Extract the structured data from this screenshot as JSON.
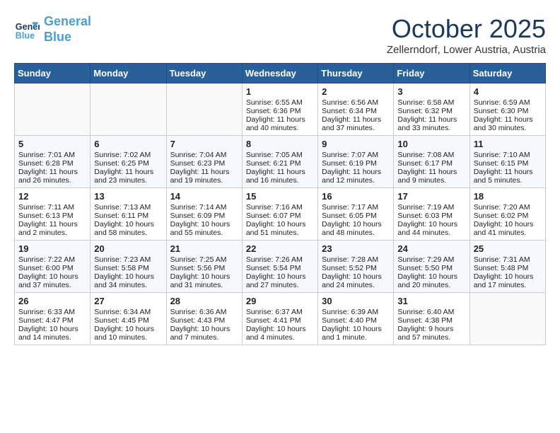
{
  "header": {
    "logo_line1": "General",
    "logo_line2": "Blue",
    "month": "October 2025",
    "location": "Zellerndorf, Lower Austria, Austria"
  },
  "weekdays": [
    "Sunday",
    "Monday",
    "Tuesday",
    "Wednesday",
    "Thursday",
    "Friday",
    "Saturday"
  ],
  "weeks": [
    [
      {
        "day": "",
        "content": ""
      },
      {
        "day": "",
        "content": ""
      },
      {
        "day": "",
        "content": ""
      },
      {
        "day": "1",
        "content": "Sunrise: 6:55 AM\nSunset: 6:36 PM\nDaylight: 11 hours\nand 40 minutes."
      },
      {
        "day": "2",
        "content": "Sunrise: 6:56 AM\nSunset: 6:34 PM\nDaylight: 11 hours\nand 37 minutes."
      },
      {
        "day": "3",
        "content": "Sunrise: 6:58 AM\nSunset: 6:32 PM\nDaylight: 11 hours\nand 33 minutes."
      },
      {
        "day": "4",
        "content": "Sunrise: 6:59 AM\nSunset: 6:30 PM\nDaylight: 11 hours\nand 30 minutes."
      }
    ],
    [
      {
        "day": "5",
        "content": "Sunrise: 7:01 AM\nSunset: 6:28 PM\nDaylight: 11 hours\nand 26 minutes."
      },
      {
        "day": "6",
        "content": "Sunrise: 7:02 AM\nSunset: 6:25 PM\nDaylight: 11 hours\nand 23 minutes."
      },
      {
        "day": "7",
        "content": "Sunrise: 7:04 AM\nSunset: 6:23 PM\nDaylight: 11 hours\nand 19 minutes."
      },
      {
        "day": "8",
        "content": "Sunrise: 7:05 AM\nSunset: 6:21 PM\nDaylight: 11 hours\nand 16 minutes."
      },
      {
        "day": "9",
        "content": "Sunrise: 7:07 AM\nSunset: 6:19 PM\nDaylight: 11 hours\nand 12 minutes."
      },
      {
        "day": "10",
        "content": "Sunrise: 7:08 AM\nSunset: 6:17 PM\nDaylight: 11 hours\nand 9 minutes."
      },
      {
        "day": "11",
        "content": "Sunrise: 7:10 AM\nSunset: 6:15 PM\nDaylight: 11 hours\nand 5 minutes."
      }
    ],
    [
      {
        "day": "12",
        "content": "Sunrise: 7:11 AM\nSunset: 6:13 PM\nDaylight: 11 hours\nand 2 minutes."
      },
      {
        "day": "13",
        "content": "Sunrise: 7:13 AM\nSunset: 6:11 PM\nDaylight: 10 hours\nand 58 minutes."
      },
      {
        "day": "14",
        "content": "Sunrise: 7:14 AM\nSunset: 6:09 PM\nDaylight: 10 hours\nand 55 minutes."
      },
      {
        "day": "15",
        "content": "Sunrise: 7:16 AM\nSunset: 6:07 PM\nDaylight: 10 hours\nand 51 minutes."
      },
      {
        "day": "16",
        "content": "Sunrise: 7:17 AM\nSunset: 6:05 PM\nDaylight: 10 hours\nand 48 minutes."
      },
      {
        "day": "17",
        "content": "Sunrise: 7:19 AM\nSunset: 6:03 PM\nDaylight: 10 hours\nand 44 minutes."
      },
      {
        "day": "18",
        "content": "Sunrise: 7:20 AM\nSunset: 6:02 PM\nDaylight: 10 hours\nand 41 minutes."
      }
    ],
    [
      {
        "day": "19",
        "content": "Sunrise: 7:22 AM\nSunset: 6:00 PM\nDaylight: 10 hours\nand 37 minutes."
      },
      {
        "day": "20",
        "content": "Sunrise: 7:23 AM\nSunset: 5:58 PM\nDaylight: 10 hours\nand 34 minutes."
      },
      {
        "day": "21",
        "content": "Sunrise: 7:25 AM\nSunset: 5:56 PM\nDaylight: 10 hours\nand 31 minutes."
      },
      {
        "day": "22",
        "content": "Sunrise: 7:26 AM\nSunset: 5:54 PM\nDaylight: 10 hours\nand 27 minutes."
      },
      {
        "day": "23",
        "content": "Sunrise: 7:28 AM\nSunset: 5:52 PM\nDaylight: 10 hours\nand 24 minutes."
      },
      {
        "day": "24",
        "content": "Sunrise: 7:29 AM\nSunset: 5:50 PM\nDaylight: 10 hours\nand 20 minutes."
      },
      {
        "day": "25",
        "content": "Sunrise: 7:31 AM\nSunset: 5:48 PM\nDaylight: 10 hours\nand 17 minutes."
      }
    ],
    [
      {
        "day": "26",
        "content": "Sunrise: 6:33 AM\nSunset: 4:47 PM\nDaylight: 10 hours\nand 14 minutes."
      },
      {
        "day": "27",
        "content": "Sunrise: 6:34 AM\nSunset: 4:45 PM\nDaylight: 10 hours\nand 10 minutes."
      },
      {
        "day": "28",
        "content": "Sunrise: 6:36 AM\nSunset: 4:43 PM\nDaylight: 10 hours\nand 7 minutes."
      },
      {
        "day": "29",
        "content": "Sunrise: 6:37 AM\nSunset: 4:41 PM\nDaylight: 10 hours\nand 4 minutes."
      },
      {
        "day": "30",
        "content": "Sunrise: 6:39 AM\nSunset: 4:40 PM\nDaylight: 10 hours\nand 1 minute."
      },
      {
        "day": "31",
        "content": "Sunrise: 6:40 AM\nSunset: 4:38 PM\nDaylight: 9 hours\nand 57 minutes."
      },
      {
        "day": "",
        "content": ""
      }
    ]
  ]
}
